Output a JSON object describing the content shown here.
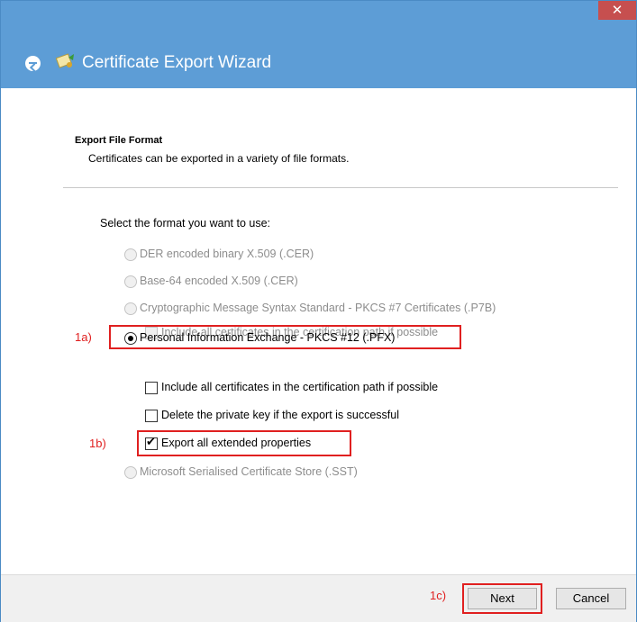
{
  "window": {
    "title": "Certificate Export Wizard",
    "close_glyph": "✕"
  },
  "header": {
    "section_title": "Export File Format",
    "section_desc": "Certificates can be exported in a variety of file formats."
  },
  "prompt": "Select the format you want to use:",
  "options": {
    "der": "DER encoded binary X.509 (.CER)",
    "base64": "Base-64 encoded X.509 (.CER)",
    "pkcs7": "Cryptographic Message Syntax Standard - PKCS #7 Certificates (.P7B)",
    "pkcs7_include": "Include all certificates in the certification path if possible",
    "pfx": "Personal Information Exchange - PKCS #12 (.PFX)",
    "pfx_include": "Include all certificates in the certification path if possible",
    "pfx_delete": "Delete the private key if the export is successful",
    "pfx_export_ext": "Export all extended properties",
    "sst": "Microsoft Serialised Certificate Store (.SST)"
  },
  "annotations": {
    "a": "1a)",
    "b": "1b)",
    "c": "1c)",
    "color": "#e02020"
  },
  "buttons": {
    "next": "Next",
    "cancel": "Cancel"
  },
  "colors": {
    "titlebar": "#5d9dd6",
    "close": "#c64f4f"
  }
}
